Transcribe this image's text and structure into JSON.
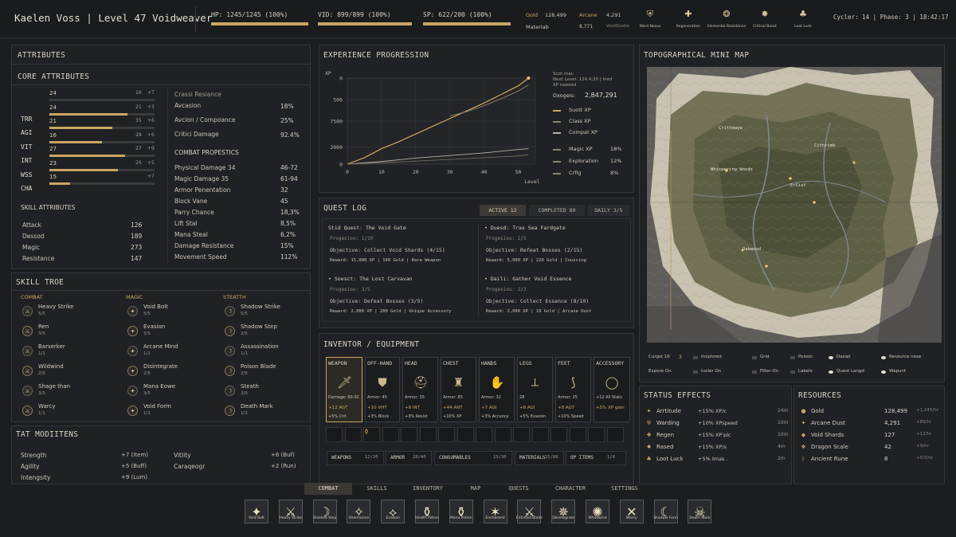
{
  "header": {
    "char_name": "Kaelen Voss | Level 47 Voidweaver",
    "hp": "HP: 1245/1245 (100%)",
    "mp": "VID: 899/899 (100%)",
    "sp": "SP: 622/200 (100%)",
    "hp_pct": 100,
    "mp_pct": 100,
    "sp_pct": 100,
    "gold_label": "Gold",
    "gold_val": "128,499",
    "arcane_label": "Arcane",
    "arcane_val": "4,291",
    "mat_label": "Materiab",
    "mat_val": "8,771",
    "mat_extra": "VoidStudio",
    "icons": [
      {
        "label": "Ward Nexus",
        "icon": "ward-icon"
      },
      {
        "label": "Regeneration",
        "icon": "regen-icon"
      },
      {
        "label": "Elemental Resistance",
        "icon": "element-icon"
      },
      {
        "label": "Critical Boost",
        "icon": "crit-icon"
      },
      {
        "label": "Loot Luck",
        "icon": "loot-icon"
      }
    ],
    "cycle": "Cycler: 14 | Phase: 3 | 18:42:17"
  },
  "attributes": {
    "title": "ATTRIBUTES",
    "core_title": "CORE ATTRIBUTES",
    "core": [
      {
        "name": "",
        "val": "24",
        "a": "16",
        "b": "+7",
        "pct": 0
      },
      {
        "name": "TRR",
        "val": "24",
        "a": "21",
        "b": "+3",
        "pct": 0.74
      },
      {
        "name": "AGI",
        "val": "21",
        "a": "35",
        "b": "+6",
        "pct": 0.6
      },
      {
        "name": "VIT",
        "val": "16",
        "a": "28",
        "b": "+6",
        "pct": 0.5
      },
      {
        "name": "INT",
        "val": "27",
        "a": "27",
        "b": "+9",
        "pct": 0.72
      },
      {
        "name": "WSS",
        "val": "23",
        "a": "26",
        "b": "+5",
        "pct": 0.65
      },
      {
        "name": "CHA",
        "val": "15",
        "a": "",
        "b": "+7",
        "pct": 0.2
      }
    ],
    "crit_title": "Crassi Resiance",
    "crit": [
      {
        "name": "Avcasion",
        "val": "18%"
      },
      {
        "name": "Avcion / Compoance",
        "val": "25%"
      },
      {
        "name": "Critici Damage",
        "val": "92.4%"
      }
    ],
    "combat_title": "COMBAT PROPESTICS",
    "combat": [
      {
        "name": "Physical Damage 34",
        "val": "46-72"
      },
      {
        "name": "Magic Damage 35",
        "val": "61-94"
      },
      {
        "name": "Armor Penentation",
        "val": "32"
      },
      {
        "name": "Block Vane",
        "val": "45"
      },
      {
        "name": "Parry Chance",
        "val": "18,3%"
      },
      {
        "name": "Lift Stal",
        "val": "8,5%"
      },
      {
        "name": "Mana Steal",
        "val": "6,2%"
      },
      {
        "name": "Damage Resistance",
        "val": "15%"
      },
      {
        "name": "Movement Speed",
        "val": "112%"
      }
    ],
    "skill_title": "SKILL ATTRIBUTES",
    "skill": [
      {
        "name": "Attack",
        "val": "126"
      },
      {
        "name": "Dessod",
        "val": "189"
      },
      {
        "name": "Magic",
        "val": "273"
      },
      {
        "name": "Resistance",
        "val": "147"
      }
    ]
  },
  "skilltree": {
    "title": "SKILL TROE",
    "cols": [
      {
        "name": "COMBAT",
        "items": [
          {
            "name": "Heavy Strike",
            "lvl": "5/5"
          },
          {
            "name": "Ren",
            "lvl": "3/5"
          },
          {
            "name": "Barserker",
            "lvl": "1/1"
          },
          {
            "name": "Wildwind",
            "lvl": "2/5"
          },
          {
            "name": "Shage than",
            "lvl": "3/5"
          },
          {
            "name": "Warcy",
            "lvl": "1/1"
          }
        ]
      },
      {
        "name": "MAGIC",
        "items": [
          {
            "name": "Void Bolt",
            "lvl": "5/5"
          },
          {
            "name": "Evasion",
            "lvl": "3/5"
          },
          {
            "name": "Arcane Mind",
            "lvl": "1/1"
          },
          {
            "name": "Disintegrate",
            "lvl": "2/5"
          },
          {
            "name": "Mana Eowe",
            "lvl": "3/5"
          },
          {
            "name": "Void Form",
            "lvl": "1/1"
          }
        ]
      },
      {
        "name": "STEATTH",
        "items": [
          {
            "name": "Shadow Strike",
            "lvl": "5/5"
          },
          {
            "name": "Shadow Step",
            "lvl": "2/5"
          },
          {
            "name": "Assassination",
            "lvl": "1/1"
          },
          {
            "name": "Poison Blade",
            "lvl": "2/5"
          },
          {
            "name": "Steath",
            "lvl": "3/5"
          },
          {
            "name": "Death Mark",
            "lvl": "1/1"
          }
        ]
      }
    ]
  },
  "modifiers": {
    "title": "TAT MODIITENS",
    "left": [
      {
        "name": "Strength",
        "val": "+7 (Item)"
      },
      {
        "name": "Agility",
        "val": "+5 (Buff)"
      },
      {
        "name": "Intengsity",
        "val": "+9 (Lum)"
      }
    ],
    "right": [
      {
        "name": "Vitlity",
        "val": "+6 (Buf)"
      },
      {
        "name": "Caraqeogr",
        "val": "+2 (Run)"
      }
    ]
  },
  "experience": {
    "title": "EXPERIENCE PROGRESSION",
    "note1": "Scot (nal:",
    "note2": "Next Level: 124.4,30 | Ined",
    "note3": "XP needed",
    "total_label": "Dxogeis:",
    "total_val": "2,847,291",
    "legend": [
      "Suott XP",
      "Class XP",
      "Compat XP"
    ],
    "stats": [
      {
        "name": "Magic XP",
        "val": "18%"
      },
      {
        "name": "Exploration",
        "val": "12%"
      },
      {
        "name": "Crfig",
        "val": "8%"
      }
    ]
  },
  "chart_data": {
    "type": "line",
    "xlabel": "Level",
    "ylabel": "XP",
    "xlim": [
      0,
      55
    ],
    "ylim": [
      0,
      10000
    ],
    "xticks": [
      0,
      10,
      20,
      30,
      40,
      50
    ],
    "yticks": [
      0,
      2000,
      5000,
      7500,
      10000
    ],
    "ytick_labels": [
      "0",
      "2000",
      "7500",
      "500",
      "0"
    ],
    "series": [
      {
        "name": "Suott XP",
        "color": "#d1a860",
        "x": [
          0,
          5,
          10,
          15,
          20,
          25,
          30,
          35,
          40,
          45,
          50,
          53
        ],
        "y": [
          0,
          750,
          1800,
          2600,
          3500,
          4400,
          5300,
          6200,
          7100,
          8100,
          9100,
          10000
        ]
      },
      {
        "name": "Class XP",
        "color": "#8a8577",
        "x": [
          30,
          35,
          40,
          45,
          50,
          53
        ],
        "y": [
          5600,
          6100,
          6800,
          7600,
          8500,
          9200
        ]
      },
      {
        "name": "Compat XP",
        "color": "#b7b1a3",
        "x": [
          0,
          10,
          20,
          30,
          40,
          50,
          53
        ],
        "y": [
          0,
          300,
          700,
          1000,
          1300,
          1700,
          1800
        ]
      },
      {
        "name": "",
        "color": "#6f6a60",
        "x": [
          0,
          10,
          20,
          30,
          40,
          50,
          53
        ],
        "y": [
          0,
          150,
          350,
          550,
          750,
          950,
          1100
        ]
      }
    ]
  },
  "quests": {
    "title": "QUEST LOG",
    "tabs": [
      {
        "label": "ACTIVE 12",
        "active": true
      },
      {
        "label": "COMPLETED 89",
        "active": false
      },
      {
        "label": "DAILY 3/5",
        "active": false
      }
    ],
    "items": [
      {
        "title": "Stid Quest: The Void Gate",
        "progress": "Progesiou: 1/10",
        "objective": "Objective: Collect  Void Shards (4/15)",
        "reward": "Reward:  15,000 XP | 100 Gold | Rare Weapon"
      },
      {
        "title": "• Duesd: Tras Sea Fardgate",
        "progress": "Progesiou: 2/5",
        "objective": "Objective: Refeat Bosses (2/15)",
        "reward": "Reward:  5,000 XP | 220 Gold | Couscing"
      },
      {
        "title": "• Soesct: The Lost Carvavan",
        "progress": "Progesiou: 3/5",
        "objective": "Objective: Defeat Bosses (3/5)",
        "reward": "Reward:  2,000 XP | 200 Gold | Unique Accessory"
      },
      {
        "title": "• Daili: Gather Void Essence",
        "progress": "Progesiou: 2/3",
        "objective": "Objective: Collect Essence (8/10)",
        "reward": "Reward:  2,000 XP | 10 Gold | Arcane Dust"
      }
    ]
  },
  "inventory": {
    "title": "INVENTOR / EQUIPMENT",
    "equip": [
      {
        "slot": "WEAPON",
        "l1": "Damage: 60.92",
        "l2": "+12 AGT",
        "l3": "+5% Crit"
      },
      {
        "slot": "OFF-HAND",
        "l1": "Armor: 45",
        "l2": "+10 VHT",
        "l3": "+3% Block"
      },
      {
        "slot": "HEAD",
        "l1": "Armor: 35",
        "l2": "+8 INT",
        "l3": "+3% Resist"
      },
      {
        "slot": "CHEST",
        "l1": "Armor: 85",
        "l2": "+44 ANT",
        "l3": "+10% XP"
      },
      {
        "slot": "HANDS",
        "l1": "Armor: 32",
        "l2": "+7 AGI",
        "l3": "+3% Accuncy"
      },
      {
        "slot": "LEGS",
        "l1": "28",
        "l2": "+8 AGI",
        "l3": "+5% Evasion"
      },
      {
        "slot": "FEET",
        "l1": "Armor: 25",
        "l2": "+8 AGT",
        "l3": "+10% Speed"
      },
      {
        "slot": "ACCESSORY",
        "l1": "+12 All Stats",
        "l2": "+5% XP gain",
        "l3": ""
      }
    ],
    "tabs": [
      {
        "label": "WEAPONS",
        "count": "12/20"
      },
      {
        "label": "ARMOR",
        "count": "28/40"
      },
      {
        "label": "CONSUMABLES",
        "count": "15/30"
      },
      {
        "label": "MATERIALS",
        "count": "15/80"
      },
      {
        "label": "OP ITEMS",
        "count": "1/8"
      }
    ]
  },
  "map": {
    "title": "TOPOGRAPHICAL MINI MAP",
    "places": [
      "Whispering Woods",
      "ErCist",
      "Oakwood",
      "Cithrimb",
      "Crittmaye"
    ],
    "legend": [
      {
        "label": "Curgst 16",
        "extra": "3"
      },
      {
        "label": "Inxplored"
      },
      {
        "label": "Grid"
      },
      {
        "label": "Poison"
      },
      {
        "label": "Dasiat"
      },
      {
        "label": "Resource nexe"
      },
      {
        "label": "Expore  On"
      },
      {
        "label": "Iuoler On"
      },
      {
        "label": "Filter On"
      },
      {
        "label": "Labels"
      },
      {
        "label": "Quest Langd"
      },
      {
        "label": "Wapunt"
      }
    ]
  },
  "status": {
    "title": "STATUS EFFECTS",
    "items": [
      {
        "name": "Arrtitude",
        "effect": "+15% XP/c",
        "time": "24m"
      },
      {
        "name": "Warding",
        "effect": "+10% XPspeed",
        "time": "10m"
      },
      {
        "name": "Regen",
        "effect": "+15% XP'plc",
        "time": "10m"
      },
      {
        "name": "Rased",
        "effect": "+15% XP/s",
        "time": "4m"
      },
      {
        "name": "Loot Luck",
        "effect": "+5% Imas .",
        "time": "2m"
      }
    ]
  },
  "resources": {
    "title": "RESOURCES",
    "items": [
      {
        "name": "Gold",
        "val": "128,499",
        "rate": "+1,245/hr"
      },
      {
        "name": "Arcane Dust",
        "val": "4,291",
        "rate": "+89/hr"
      },
      {
        "name": "Void Shards",
        "val": "127",
        "rate": "+12/hr"
      },
      {
        "name": "Dragon Scale",
        "val": "42",
        "rate": "+9/hr"
      },
      {
        "name": "Ancient Rune",
        "val": "8",
        "rate": "+0.5/hr"
      }
    ]
  },
  "nav": {
    "tabs": [
      {
        "label": "COMBAT",
        "active": true
      },
      {
        "label": "SKILLS",
        "active": false
      },
      {
        "label": "INVENTORY",
        "active": false
      },
      {
        "label": "MAP",
        "active": false
      },
      {
        "label": "QUESTS",
        "active": false
      },
      {
        "label": "CHARACTER",
        "active": false
      },
      {
        "label": "SETTINGS",
        "active": false
      }
    ],
    "hotbar": [
      "Void Bolt",
      "Heavy Strike",
      "Shadow Step",
      "Shemissive",
      "Evasion",
      "Health Potion",
      "Mana Potion",
      "Enchanted",
      "Entinted Blade",
      "Disintegrate",
      "Whildwind",
      "Warcy",
      "Shadow Form",
      "Death Mark"
    ]
  }
}
